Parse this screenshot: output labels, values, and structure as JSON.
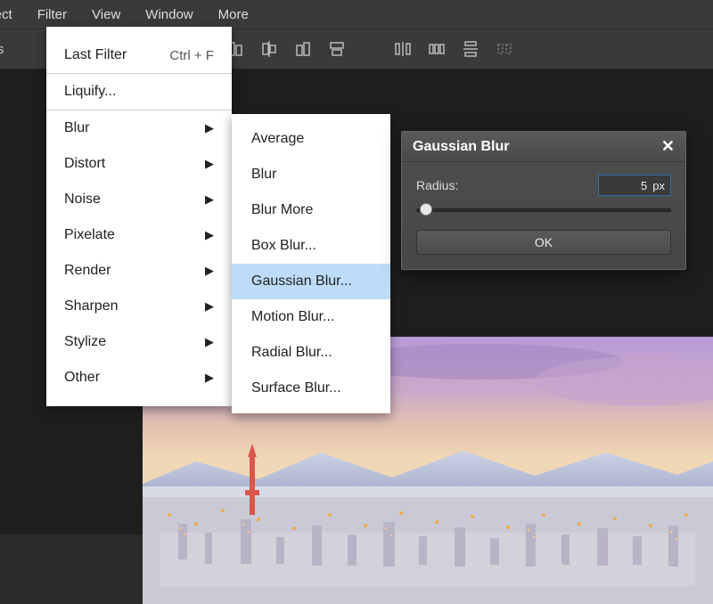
{
  "menubar": {
    "items": [
      "elect",
      "Filter",
      "View",
      "Window",
      "More"
    ]
  },
  "toolbar": {
    "label": "trols"
  },
  "filter_menu": {
    "last_filter": "Last Filter",
    "shortcut": "Ctrl + F",
    "liquify": "Liquify...",
    "groups": [
      "Blur",
      "Distort",
      "Noise",
      "Pixelate",
      "Render",
      "Sharpen",
      "Stylize",
      "Other"
    ]
  },
  "blur_menu": [
    "Average",
    "Blur",
    "Blur More",
    "Box Blur...",
    "Gaussian Blur...",
    "Motion Blur...",
    "Radial Blur...",
    "Surface Blur..."
  ],
  "dialog": {
    "title": "Gaussian Blur",
    "radius_label": "Radius:",
    "radius_value": "5",
    "radius_unit": "px",
    "ok": "OK"
  }
}
